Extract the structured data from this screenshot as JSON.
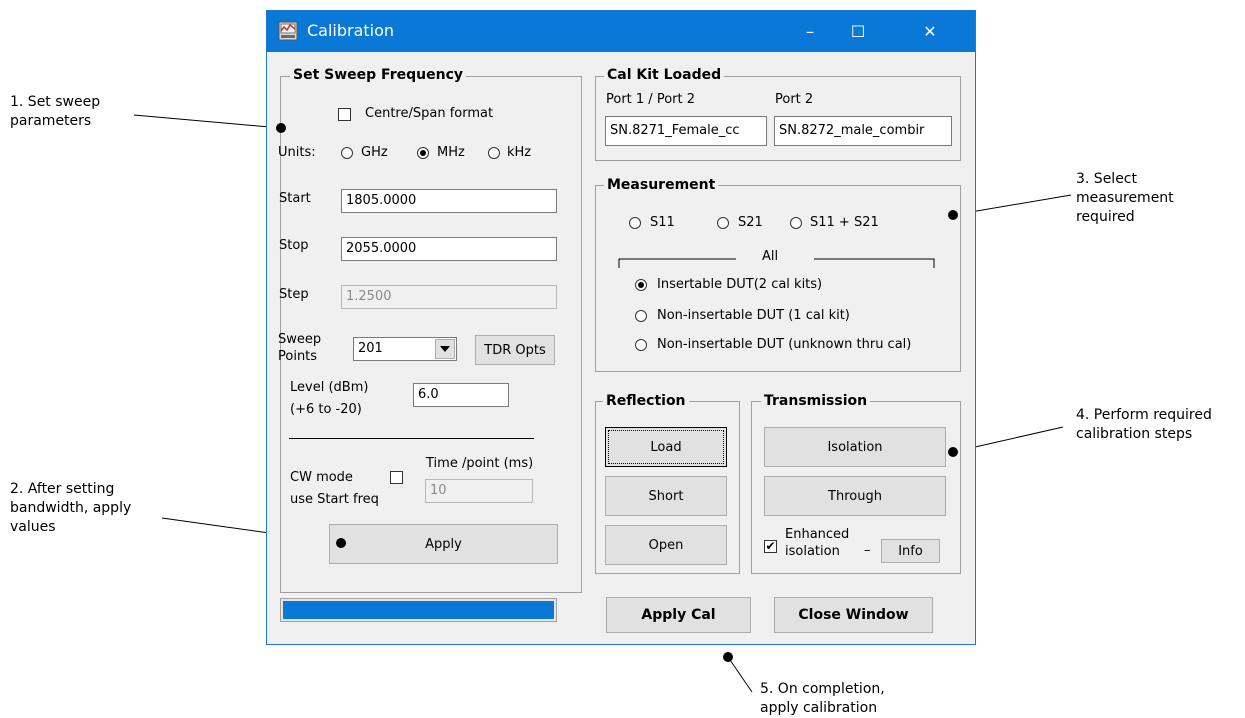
{
  "window": {
    "title": "Calibration",
    "minimize_glyph": "–",
    "maximize_glyph": "☐",
    "close_glyph": "✕"
  },
  "sweep": {
    "group_title": "Set Sweep Frequency",
    "centre_span_label": "Centre/Span format",
    "units_label": "Units:",
    "units": [
      "GHz",
      "MHz",
      "kHz"
    ],
    "units_selected": "MHz",
    "start_label": "Start",
    "start_value": "1805.0000",
    "stop_label": "Stop",
    "stop_value": "2055.0000",
    "step_label": "Step",
    "step_value": "1.2500",
    "sweep_points_label_1": "Sweep",
    "sweep_points_label_2": "Points",
    "sweep_points_value": "201",
    "tdr_button": "TDR Opts",
    "level_label_1": "Level (dBm)",
    "level_label_2": "(+6 to -20)",
    "level_value": "6.0",
    "cw_label_1": "CW mode",
    "cw_label_2": "use Start freq",
    "time_label": "Time /point (ms)",
    "time_value": "10",
    "apply_button": "Apply"
  },
  "calkit": {
    "group_title": "Cal Kit Loaded",
    "port12_label": "Port 1 / Port 2",
    "port12_value": "SN.8271_Female_cc",
    "port2_label": "Port 2",
    "port2_value": "SN.8272_male_combir"
  },
  "measurement": {
    "group_title": "Measurement",
    "options": [
      "S11",
      "S21",
      "S11 + S21"
    ],
    "all_label": "All",
    "dut_options": [
      "Insertable DUT(2 cal kits)",
      "Non-insertable DUT (1 cal kit)",
      "Non-insertable DUT (unknown thru cal)"
    ],
    "dut_selected": "Insertable DUT(2 cal kits)"
  },
  "reflection": {
    "group_title": "Reflection",
    "buttons": [
      "Load",
      "Short",
      "Open"
    ]
  },
  "transmission": {
    "group_title": "Transmission",
    "isolation_button": "Isolation",
    "through_button": "Through",
    "enhanced_label_1": "Enhanced",
    "enhanced_label_2": "isolation",
    "enhanced_checked": true,
    "dash": "–",
    "info_button": "Info"
  },
  "progress": {
    "fraction": 1.0,
    "color": "#0a78d7"
  },
  "apply_cal_button": "Apply Cal",
  "close_window_button": "Close Window",
  "annotations": {
    "a1": "1. Set sweep\nparameters",
    "a2": "2. After setting\nbandwidth, apply\nvalues",
    "a3": "3. Select\nmeasurement\nrequired",
    "a4": "4. Perform required\ncalibration steps",
    "a5": "5. On completion,\napply calibration"
  }
}
